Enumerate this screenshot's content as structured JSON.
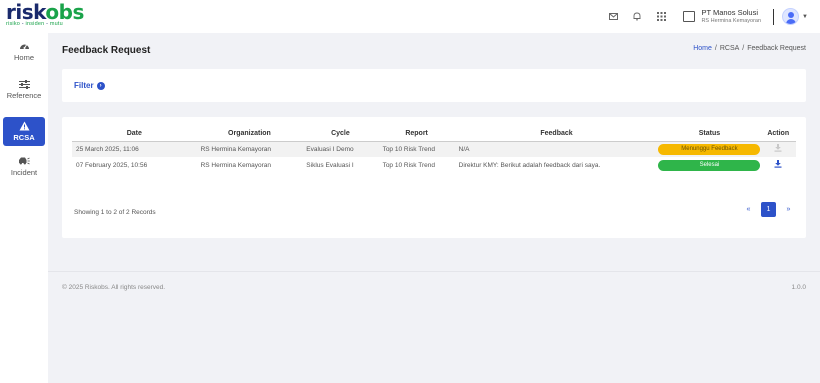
{
  "app": {
    "logo_main_a": "risk",
    "logo_main_b": "obs",
    "logo_sub_a": "risiko",
    "logo_sub_sep1": " - ",
    "logo_sub_b": "insiden",
    "logo_sub_sep2": " - ",
    "logo_sub_c": "mutu"
  },
  "header": {
    "company_name": "PT Manos Solusi",
    "company_sub": "RS Hermina Kemayoran",
    "icons": [
      "mail-icon",
      "bell-icon",
      "apps-grid-icon",
      "building-icon",
      "user-avatar-icon"
    ]
  },
  "sidebar": {
    "items": [
      {
        "label": "Home",
        "icon": "speedometer-icon"
      },
      {
        "label": "Reference",
        "icon": "sliders-icon"
      },
      {
        "label": "RCSA",
        "icon": "warning-icon",
        "active": true
      },
      {
        "label": "Incident",
        "icon": "car-crash-icon"
      }
    ]
  },
  "page": {
    "title": "Feedback Request",
    "breadcrumb": [
      "Home",
      "RCSA",
      "Feedback Request"
    ],
    "breadcrumb_sep": "/"
  },
  "filter": {
    "label": "Filter",
    "icon": "chevron-right-circle-icon"
  },
  "table": {
    "headers": [
      "Date",
      "Organization",
      "Cycle",
      "Report",
      "Feedback",
      "Status",
      "Action"
    ],
    "rows": [
      {
        "date": "25 March 2025, 11:06",
        "organization": "RS Hermina Kemayoran",
        "cycle": "Evaluasi I Demo",
        "report": "Top 10 Risk Trend",
        "feedback": "N/A",
        "status": "Menunggu Feedback",
        "status_color": "#f6b800",
        "action_icon": "download-icon",
        "action_enabled": false
      },
      {
        "date": "07 February 2025, 10:56",
        "organization": "RS Hermina Kemayoran",
        "cycle": "Siklus Evaluasi I",
        "report": "Top 10 Risk Trend",
        "feedback": "Direktur KMY: Berikut adalah feedback dari saya.",
        "status": "Selesai",
        "status_color": "#2fb54a",
        "action_icon": "download-icon",
        "action_enabled": true
      }
    ],
    "showing": "Showing 1 to 2 of 2 Records",
    "pagination": {
      "prev": "«",
      "current": "1",
      "next": "»"
    }
  },
  "footer": {
    "copyright": "© 2025 Riskobs. All rights reserved.",
    "version": "1.0.0"
  },
  "colors": {
    "primary": "#2d52c9",
    "brand_green": "#1aa34a",
    "brand_navy": "#1a2a6c"
  }
}
